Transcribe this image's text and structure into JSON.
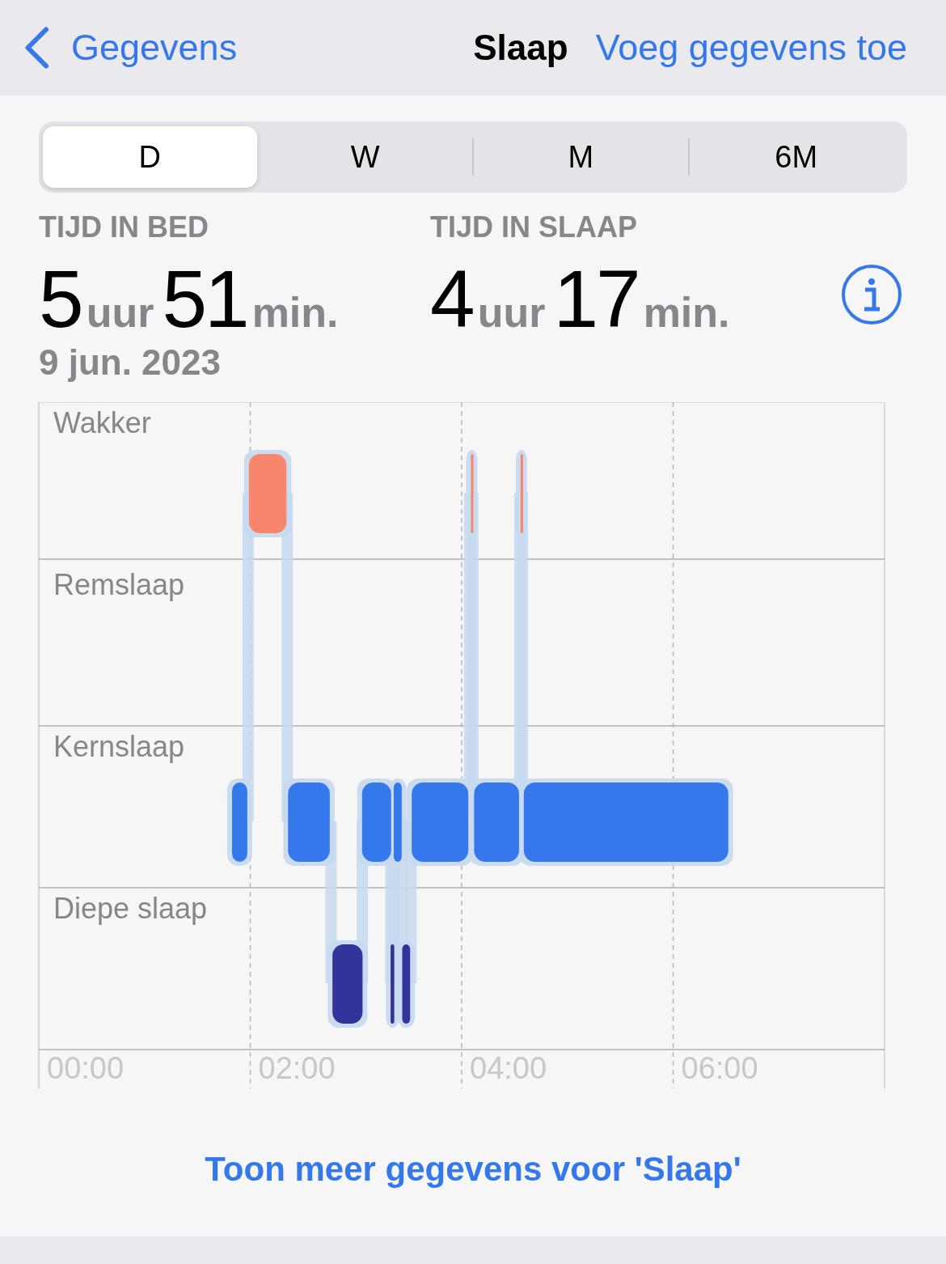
{
  "nav": {
    "back": "Gegevens",
    "title": "Slaap",
    "action": "Voeg gegevens toe"
  },
  "periods": [
    {
      "label": "D",
      "selected": true
    },
    {
      "label": "W",
      "selected": false
    },
    {
      "label": "M",
      "selected": false
    },
    {
      "label": "6M",
      "selected": false
    }
  ],
  "stats": [
    {
      "label": "TIJD IN BED",
      "hours": "5",
      "hours_unit": "uur",
      "minutes": "51",
      "minutes_unit": "min."
    },
    {
      "label": "TIJD IN SLAAP",
      "hours": "4",
      "hours_unit": "uur",
      "minutes": "17",
      "minutes_unit": "min."
    }
  ],
  "date": "9 jun. 2023",
  "sleep_chart": {
    "rows": [
      "Wakker",
      "Remslaap",
      "Kernslaap",
      "Diepe slaap"
    ],
    "ticks": [
      "00:00",
      "02:00",
      "04:00",
      "06:00"
    ]
  },
  "more_link": "Toon meer gegevens voor 'Slaap'"
}
